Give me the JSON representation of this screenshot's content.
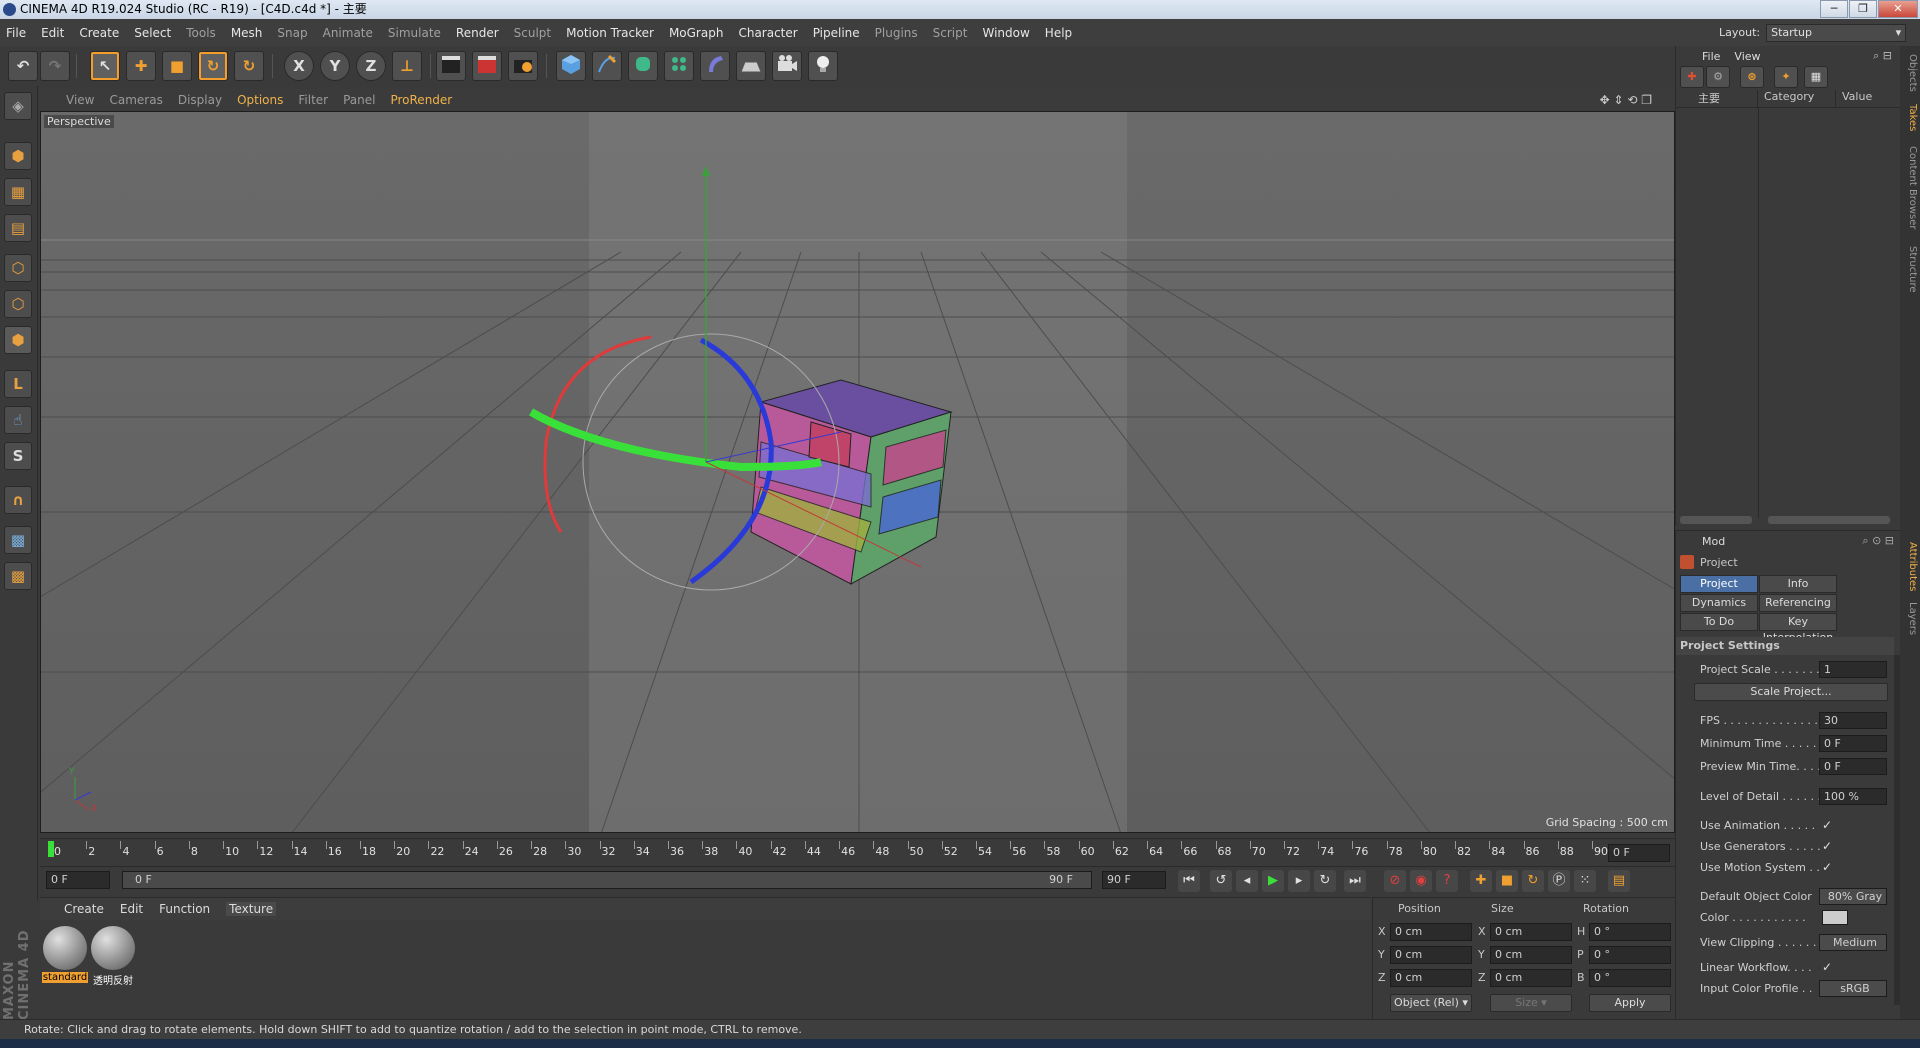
{
  "window": {
    "title": "CINEMA 4D R19.024 Studio (RC - R19) - [C4D.c4d *] - 主要",
    "minimize": "─",
    "restore": "❐",
    "close": "✕"
  },
  "menus": [
    "File",
    "Edit",
    "Create",
    "Select",
    "Tools",
    "Mesh",
    "Snap",
    "Animate",
    "Simulate",
    "Render",
    "Sculpt",
    "Motion Tracker",
    "MoGraph",
    "Character",
    "Pipeline",
    "Plugins",
    "Script",
    "Window",
    "Help"
  ],
  "layout": {
    "label": "Layout:",
    "value": "Startup"
  },
  "toolbar": {
    "undo": "↶",
    "redo": "↷",
    "live_select": "↖",
    "move": "✚",
    "scale": "■",
    "rotate": "↻",
    "recent": "↻",
    "x": "X",
    "y": "Y",
    "z": "Z",
    "coord": "⊥"
  },
  "viewport": {
    "menu": [
      "View",
      "Cameras",
      "Display",
      "Options",
      "Filter",
      "Panel",
      "ProRender"
    ],
    "active_menu": "Options",
    "camera": "Perspective",
    "grid_spacing": "Grid Spacing : 500 cm",
    "axis_y": "Y",
    "axis_x": "X"
  },
  "timeline": {
    "ticks": [
      "0",
      "2",
      "4",
      "6",
      "8",
      "10",
      "12",
      "14",
      "16",
      "18",
      "20",
      "22",
      "24",
      "26",
      "28",
      "30",
      "32",
      "34",
      "36",
      "38",
      "40",
      "42",
      "44",
      "46",
      "48",
      "50",
      "52",
      "54",
      "56",
      "58",
      "60",
      "62",
      "64",
      "66",
      "68",
      "70",
      "72",
      "74",
      "76",
      "78",
      "80",
      "82",
      "84",
      "86",
      "88",
      "90"
    ],
    "current_frame": "0 F"
  },
  "transport": {
    "start": "0 F",
    "range_start": "0 F",
    "range_end": "90 F",
    "end": "90 F"
  },
  "materials": {
    "menu": [
      "Create",
      "Edit",
      "Function",
      "Texture"
    ],
    "items": [
      "standard",
      "透明反射"
    ]
  },
  "maxon_logo": "MAXON CINEMA 4D",
  "coordinates": {
    "headers": [
      "Position",
      "Size",
      "Rotation"
    ],
    "rows": [
      {
        "axis": "X",
        "pos": "0 cm",
        "saxis": "X",
        "size": "0 cm",
        "raxis": "H",
        "rot": "0 °"
      },
      {
        "axis": "Y",
        "pos": "0 cm",
        "saxis": "Y",
        "size": "0 cm",
        "raxis": "P",
        "rot": "0 °"
      },
      {
        "axis": "Z",
        "pos": "0 cm",
        "saxis": "Z",
        "size": "0 cm",
        "raxis": "B",
        "rot": "0 °"
      }
    ],
    "mode": "Object (Rel)",
    "size_mode": "Size",
    "apply": "Apply"
  },
  "status": "Rotate: Click and drag to rotate elements. Hold down SHIFT to add to quantize rotation / add to the selection in point mode, CTRL to remove.",
  "objects": {
    "menu": [
      "File",
      "View"
    ],
    "columns": [
      "主要",
      "Category",
      "Value"
    ]
  },
  "attributes": {
    "mode": "Mod",
    "object": "Project",
    "tabs": [
      "Project Settings",
      "Info",
      "Dynamics",
      "Referencing",
      "To Do",
      "Key Interpolation"
    ],
    "section": "Project Settings",
    "rows": {
      "project_scale": {
        "label": "Project Scale . . . . . . .",
        "value": "1"
      },
      "scale_project": "Scale Project...",
      "fps": {
        "label": "FPS . . . . . . . . . . . . . . .",
        "value": "30"
      },
      "min_time": {
        "label": "Minimum Time . . . . . .",
        "value": "0 F"
      },
      "preview_min": {
        "label": "Preview Min Time. . . .",
        "value": "0 F"
      },
      "lod": {
        "label": "Level of Detail . . . . . .",
        "value": "100 %"
      },
      "use_animation": {
        "label": "Use Animation . . . . .",
        "value": "✓"
      },
      "use_generators": {
        "label": "Use Generators . . . . .",
        "value": "✓"
      },
      "use_motion": {
        "label": "Use Motion System . .",
        "value": "✓"
      },
      "default_color": {
        "label": "Default Object Color",
        "value": "80% Gray"
      },
      "color": {
        "label": "Color . . . . . . . . . . ."
      },
      "view_clipping": {
        "label": "View Clipping . . . . . .",
        "value": "Medium"
      },
      "linear_workflow": {
        "label": "Linear Workflow. . . .",
        "value": "✓"
      },
      "input_profile": {
        "label": "Input Color Profile . .",
        "value": "sRGB"
      }
    }
  },
  "side_tabs": [
    "Objects",
    "Takes",
    "Content Browser",
    "Structure",
    "Attributes",
    "Layers"
  ]
}
